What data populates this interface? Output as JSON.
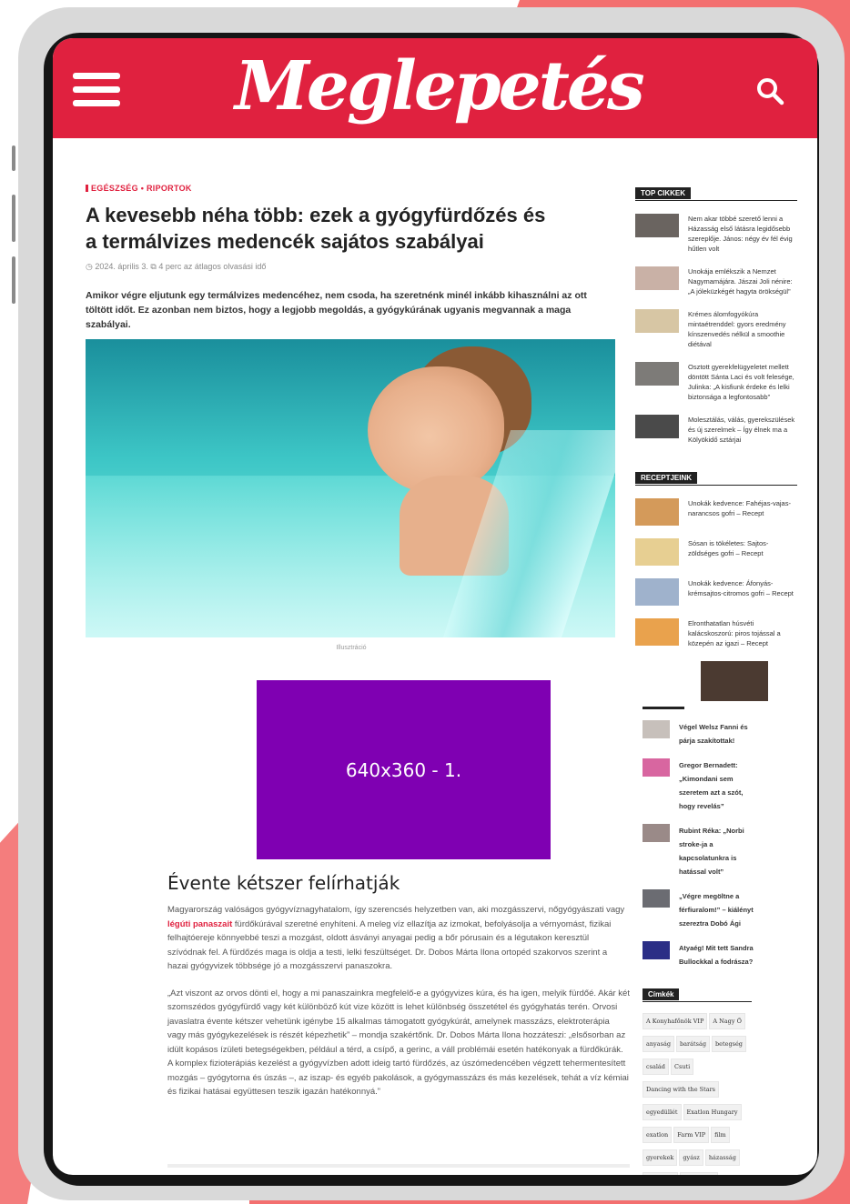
{
  "site": {
    "logo": "Meglepetés"
  },
  "article": {
    "kicker": "EGÉSZSÉG • RIPORTOK",
    "title": "A kevesebb néha több: ezek a gyógyfürdőzés és a termálvizes medencék sajátos szabályai",
    "meta": "◷ 2024. április 3.   ⧉ 4 perc az átlagos olvasási idő",
    "lead": "Amikor végre eljutunk egy termálvizes medencéhez, nem csoda, ha szeretnénk minél inkább kihasználni az ott töltött időt. Ez azonban nem biztos, hogy a legjobb megoldás, a gyógykúrának ugyanis megvannak a maga szabályai.",
    "image_caption": "Illusztráció",
    "ad_label": "640x360 - 1.",
    "section_title": "Évente kétszer felírhatják",
    "p1_before": "Magyarország valóságos gyógyvíznagyhatalom, így szerencsés helyzetben van, aki mozgásszervi, nőgyógyászati vagy ",
    "p1_highlight": "légúti panaszait",
    "p1_after": " fürdőkúrával szeretné enyhíteni. A meleg víz ellazítja az izmokat, befolyásolja a vérnyomást, fizikai felhajtóereje könnyebbé teszi a mozgást, oldott ásványi anyagai pedig a bőr pórusain és a légutakon keresztül szívódnak fel. A fürdőzés maga is oldja a testi, lelki feszültséget. Dr. Dobos Márta Ilona ortopéd szakorvos szerint a hazai gyógyvizek többsége jó a mozgásszervi panaszokra.",
    "p2": "„Azt viszont az orvos dönti el, hogy a mi panaszainkra megfelelő-e a gyógyvizes kúra, és ha igen, melyik fürdőé. Akár két szomszédos gyógyfürdő vagy két különböző kút vize között is lehet különbség összetétel és gyógyhatás terén. Orvosi javaslatra évente kétszer vehetünk igénybe 15 alkalmas támogatott gyógykúrát, amelynek masszázs, elektroterápia vagy más gyógykezelések is részét képezhetik” – mondja szakértőnk. Dr. Dobos Márta Ilona hozzáteszi: „elsősorban az idült kopásos ízületi betegségekben, például a térd, a csípő, a gerinc, a váll problémái esetén hatékonyak a fürdőkúrák. A komplex fizioterápiás kezelést a gyógyvízben adott ideig tartó fürdőzés, az úszómedencében végzett tehermentesített mozgás – gyógytorna és úszás –, az iszap- és egyéb pakolások, a gyógymasszázs és más kezelések, tehát a víz kémiai és fizikai hatásai együttesen teszik igazán hatékonnyá.”"
  },
  "sidebar": {
    "top_heading": "TOP CIKKEK",
    "top_items": [
      {
        "text": "Nem akar többé szerető lenni a Házasság első látásra legidősebb szereplője. János: négy év fél évig hűtlen volt"
      },
      {
        "text": "Unokája emlékszik a Nemzet Nagymamájára. Jászai Joli nénire: „A jóleküzkégét hagyta örökségül”"
      },
      {
        "text": "Krémes álomfogyókúra mintaétrenddel: gyors eredmény kínszenvedés nélkül a smoothie diétával"
      },
      {
        "text": "Osztott gyerekfelügyeletet mellett döntött Sánta Laci és volt felesége, Julinka: „A kisfiunk érdeke és lelki biztonsága a legfontosabb”"
      },
      {
        "text": "Molesztálás, válás, gyerekszülések és új szerelmek – Így élnek ma a Kölyökidő sztárjai"
      }
    ],
    "recipe_heading": "RECEPTJEINK",
    "recipes": [
      {
        "text": "Unokák kedvence: Fahéjas-vajas-narancsos gofri – Recept"
      },
      {
        "text": "Sósan is tökéletes: Sajtos-zöldséges gofri – Recept"
      },
      {
        "text": "Unokák kedvence: Áfonyás-krémsajtos-citromos gofri – Recept"
      },
      {
        "text": "Elronthatatlan húsvéti kalácskoszorú: piros tojással a közepén az igazi – Recept"
      }
    ],
    "celebs": [
      {
        "text": "Végel Welsz Fanni és párja szakítottak!"
      },
      {
        "text": "Gregor Bernadett: „Kimondani sem szeretem azt a szót, hogy revelás”"
      },
      {
        "text": "Rubint Réka: „Norbi stroke-ja a kapcsolatunkra is hatással volt”"
      },
      {
        "text": "„Végre megöltne a férfiuralom!” – kiálényt szereztra Dobó Ági"
      },
      {
        "text": "Atyaég! Mit tett Sandra Bullockkal a fodrásza?"
      }
    ],
    "tags_heading": "Címkék",
    "tags": [
      "A Konyhafőnök VIP",
      "A Nagy Ő",
      "anyaság",
      "barátság",
      "betegség",
      "család",
      "Csuti",
      "Dancing with the Stars",
      "egyedüllét",
      "Exatlon Hungary",
      "exatlon",
      "Farm VIP",
      "film",
      "gyerekek",
      "gyász",
      "házasság",
      "kapcsolat",
      "karácsony"
    ]
  },
  "colors": {
    "brand_red": "#e0213f",
    "ad_purple": "#7f00b2"
  }
}
